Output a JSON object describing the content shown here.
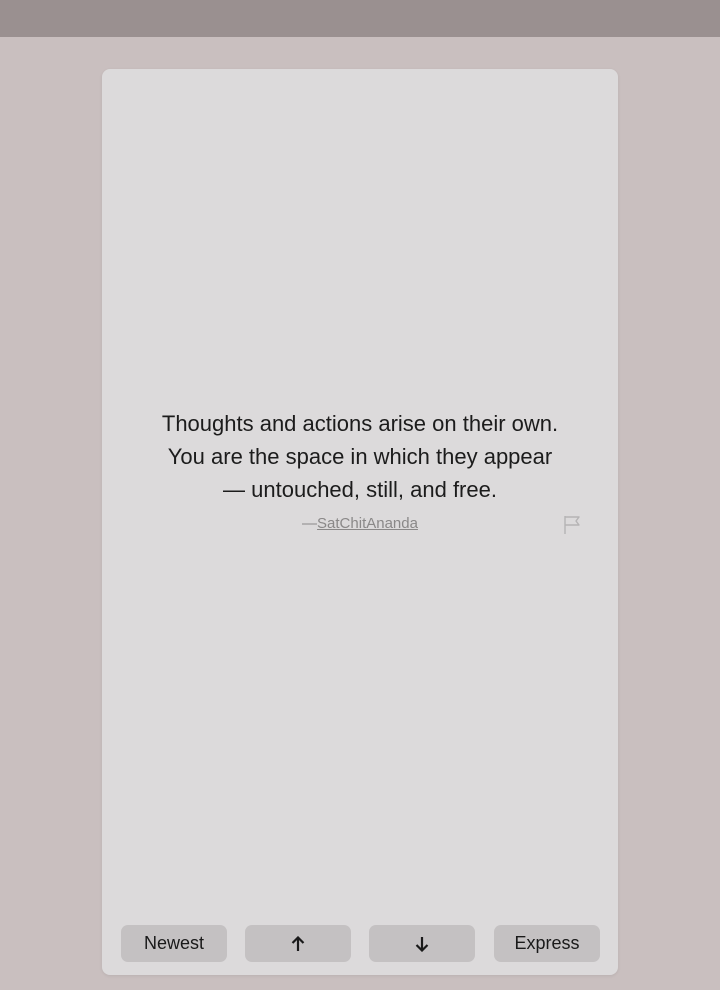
{
  "quote": {
    "lines": [
      "Thoughts and actions arise on their own.",
      "You are the space in which they appear",
      "— untouched, still, and free."
    ],
    "dash": "—",
    "author": "SatChitAnanda"
  },
  "controls": {
    "newest_label": "Newest",
    "up_icon": "arrow-up-icon",
    "down_icon": "arrow-down-icon",
    "express_label": "Express"
  },
  "colors": {
    "background": "#c9bfbf",
    "top_bar": "#9a9090",
    "card": "#dcdadb",
    "button": "#c4c1c2"
  }
}
